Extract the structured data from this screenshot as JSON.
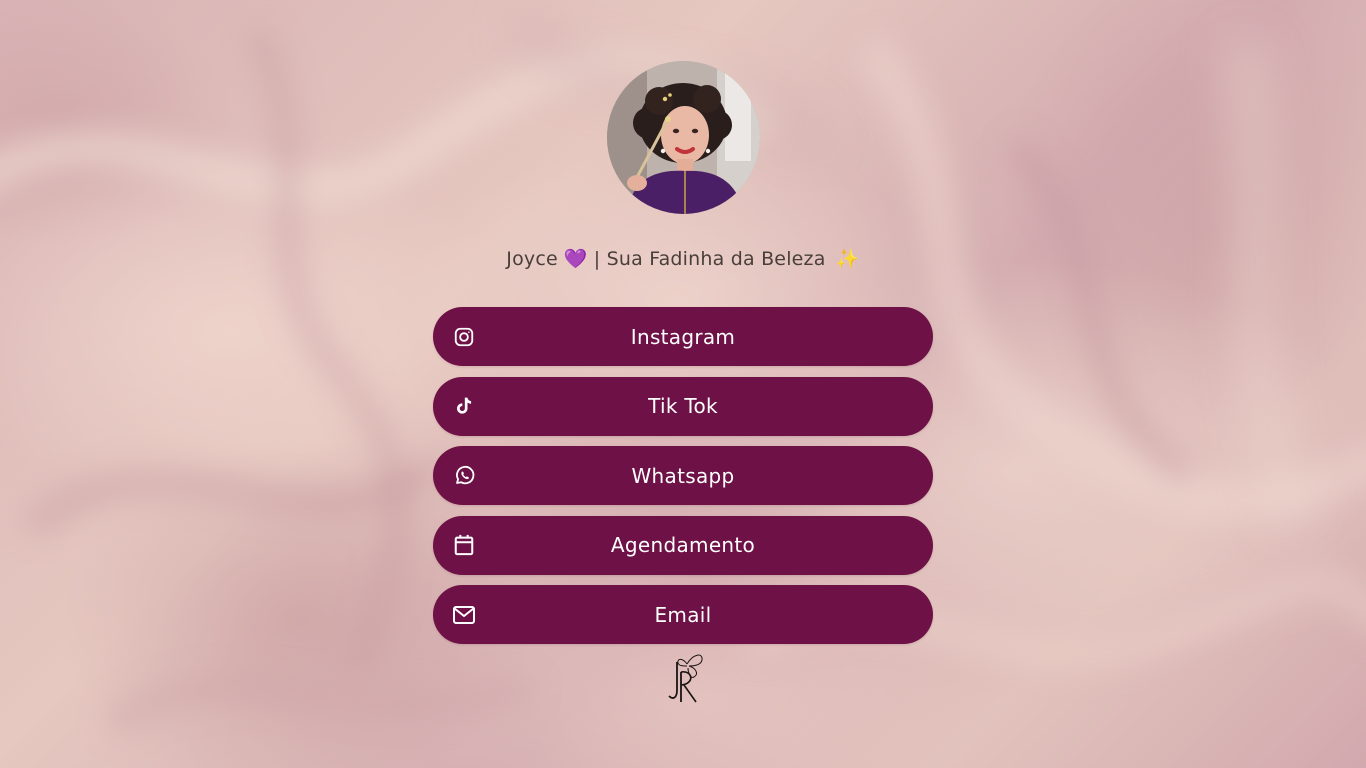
{
  "profile": {
    "name": "Joyce",
    "heart_emoji": "💜",
    "separator_tagline": "| Sua Fadinha da Beleza",
    "sparkle_emoji": "✨",
    "avatar_icon": "profile-photo"
  },
  "links": [
    {
      "label": "Instagram",
      "icon": "instagram-icon"
    },
    {
      "label": "Tik Tok",
      "icon": "tiktok-icon"
    },
    {
      "label": "Whatsapp",
      "icon": "whatsapp-icon"
    },
    {
      "label": "Agendamento",
      "icon": "calendar-icon"
    },
    {
      "label": "Email",
      "icon": "envelope-icon"
    }
  ],
  "colors": {
    "button_bg": "#6e1146",
    "button_text": "#ffffff",
    "title_text": "#4a3e3a"
  },
  "footer": {
    "logo_icon": "jr-butterfly-logo"
  }
}
